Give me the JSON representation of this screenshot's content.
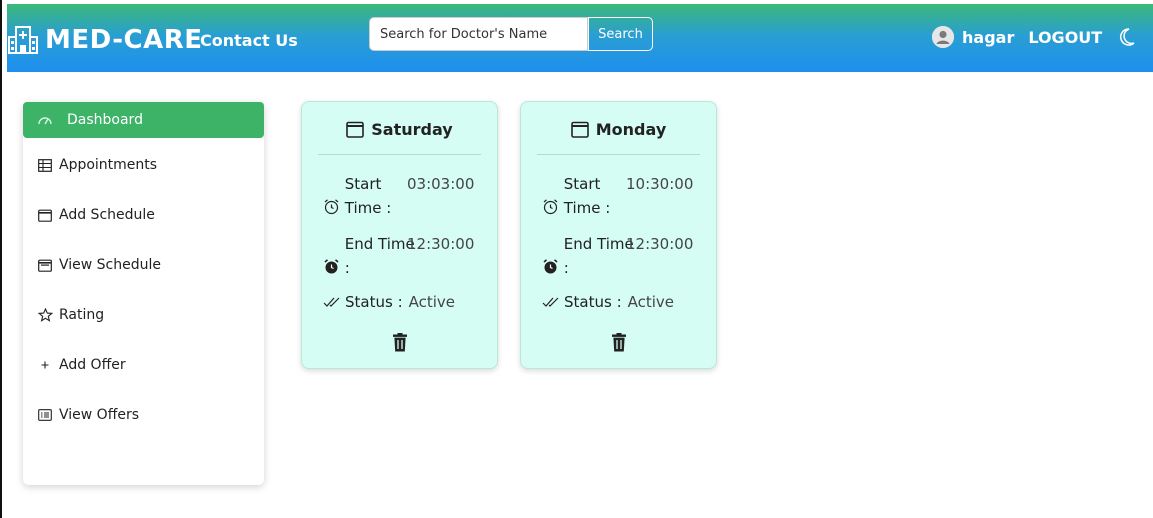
{
  "navbar": {
    "brand": "MED-CARE",
    "contact": "Contact Us",
    "search_placeholder": "Search for Doctor's Name",
    "search_button": "Search",
    "username": "hagar",
    "logout": "LOGOUT"
  },
  "sidebar": {
    "items": [
      {
        "label": "Dashboard",
        "icon": "dashboard-icon"
      },
      {
        "label": "Appointments",
        "icon": "table-icon"
      },
      {
        "label": "Add Schedule",
        "icon": "calendar-icon"
      },
      {
        "label": "View Schedule",
        "icon": "calendar-view-icon"
      },
      {
        "label": "Rating",
        "icon": "star-icon"
      },
      {
        "label": "Add Offer",
        "icon": "plus-icon"
      },
      {
        "label": "View Offers",
        "icon": "list-icon"
      }
    ]
  },
  "cards": [
    {
      "day": "Saturday",
      "start_label": "Start Time :",
      "start": "03:03:00",
      "end_label": "End Time :",
      "end": "12:30:00",
      "status_label": "Status :",
      "status": "Active"
    },
    {
      "day": "Monday",
      "start_label": "Start Time :",
      "start": "10:30:00",
      "end_label": "End Time :",
      "end": "12:30:00",
      "status_label": "Status :",
      "status": "Active"
    }
  ],
  "colors": {
    "navbar_top": "#3cb878",
    "navbar_bottom": "#1e8ff0",
    "active_sidebar": "#3db368",
    "card_bg": "#d6fdf3"
  }
}
